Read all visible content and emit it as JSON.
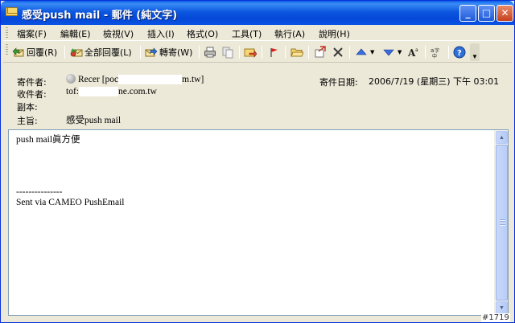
{
  "window": {
    "title": "感受push mail - 郵件 (純文字)",
    "buttons": {
      "minimize": "_",
      "maximize": "□",
      "close": "✕"
    }
  },
  "menu": {
    "items": [
      "檔案(F)",
      "編輯(E)",
      "檢視(V)",
      "插入(I)",
      "格式(O)",
      "工具(T)",
      "執行(A)",
      "說明(H)"
    ]
  },
  "toolbar": {
    "reply": "回覆(R)",
    "reply_all": "全部回覆(L)",
    "forward": "轉寄(W)"
  },
  "header": {
    "from_label": "寄件者:",
    "from_prefix": "Recer [poc",
    "from_suffix": "m.tw]",
    "to_label": "收件者:",
    "to_prefix": "tof:",
    "to_suffix": "ne.com.tw",
    "cc_label": "副本:",
    "subject_label": "主旨:",
    "subject": "感受push mail",
    "sent_label": "寄件日期:",
    "sent_value": "2006/7/19 (星期三) 下午 03:01"
  },
  "message": {
    "lines": [
      "push mail眞方便",
      "",
      "",
      "",
      "",
      "---------------",
      "Sent via CAMEO PushEmail"
    ]
  },
  "watermark": "#1719",
  "colors": {
    "title_bar": "#0448d8",
    "window_face": "#ece9d8",
    "body_border": "#7f9db9"
  }
}
